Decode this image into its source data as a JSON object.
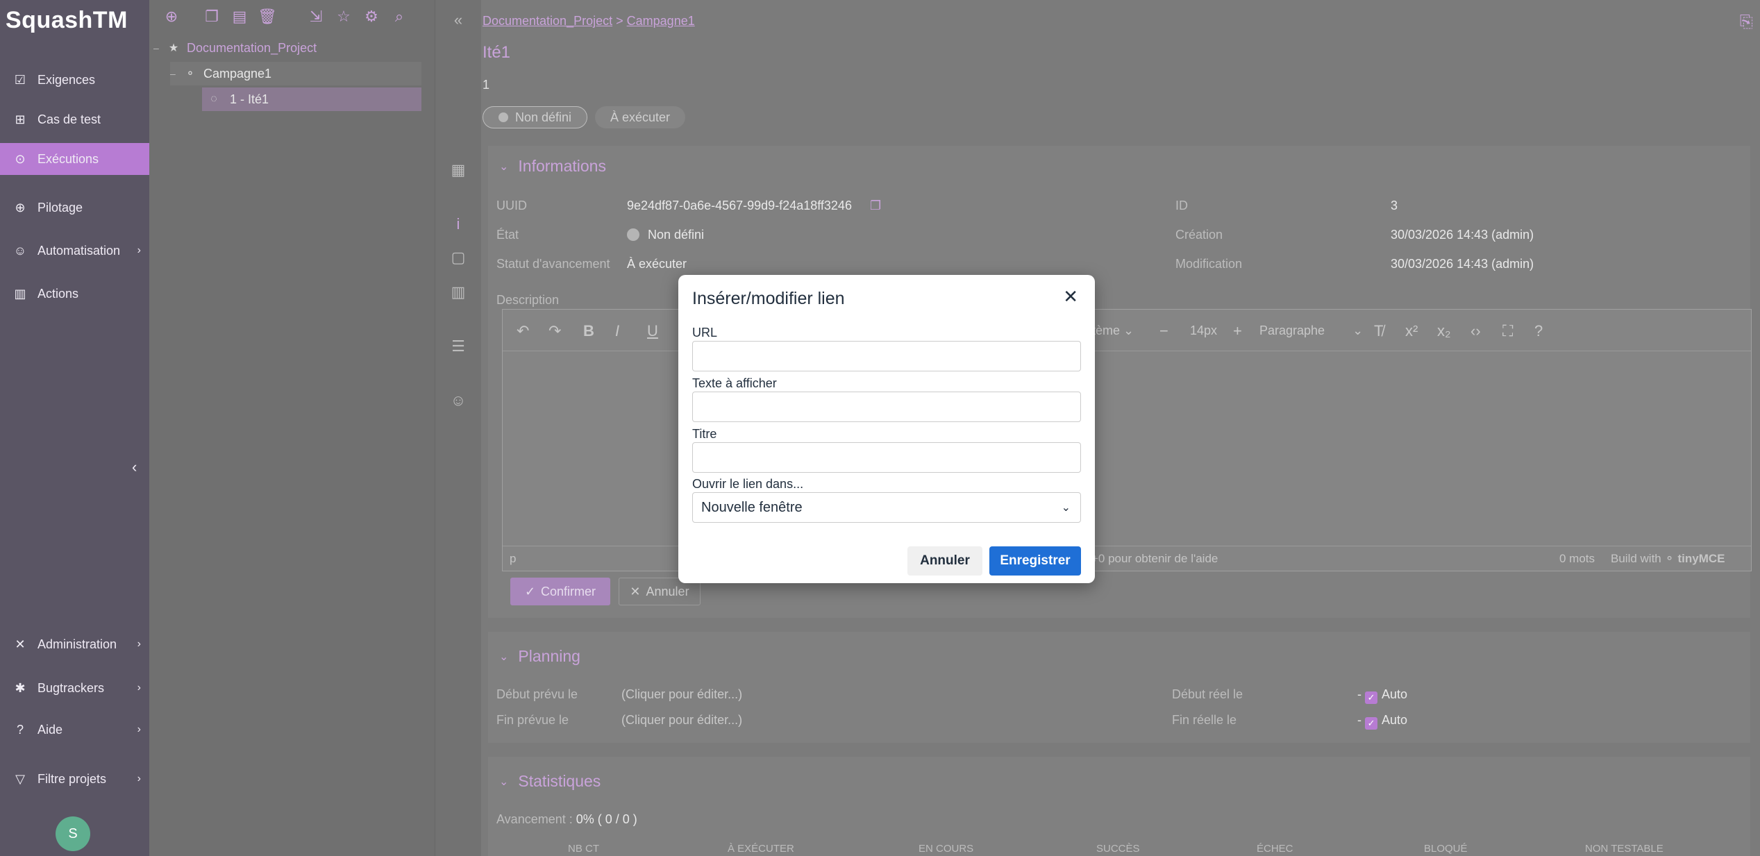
{
  "nav": {
    "logo": "SquashTM",
    "items": [
      {
        "label": "Exigences",
        "icon": "requirement-icon"
      },
      {
        "label": "Cas de test",
        "icon": "testcase-icon"
      },
      {
        "label": "Exécutions",
        "icon": "play-icon"
      },
      {
        "label": "Pilotage",
        "icon": "globe-icon"
      },
      {
        "label": "Automatisation",
        "icon": "robot-icon"
      },
      {
        "label": "Actions",
        "icon": "books-icon"
      },
      {
        "label": "Administration",
        "icon": "tools-icon"
      },
      {
        "label": "Bugtrackers",
        "icon": "bug-icon"
      },
      {
        "label": "Aide",
        "icon": "help-icon"
      },
      {
        "label": "Filtre projets",
        "icon": "filter-icon"
      }
    ],
    "avatar": "S"
  },
  "tree": {
    "project": "Documentation_Project",
    "campaign": "Campagne1",
    "iteration": "1 - Ité1"
  },
  "main": {
    "breadcrumb_project": "Documentation_Project",
    "breadcrumb_sep": ">",
    "breadcrumb_campaign": "Campagne1",
    "title": "Ité1",
    "reference": "1",
    "status_pill": "Non défini",
    "progress_pill": "À exécuter",
    "informations": {
      "heading": "Informations",
      "uuid_label": "UUID",
      "uuid_value": "9e24df87-0a6e-4567-99d9-f24a18ff3246",
      "state_label": "État",
      "state_value": "Non défini",
      "progress_label": "Statut d'avancement",
      "progress_value": "À exécuter",
      "id_label": "ID",
      "id_value": "3",
      "creation_label": "Création",
      "creation_value": "30/03/2026 14:43 (admin)",
      "modification_label": "Modification",
      "modification_value": "30/03/2026 14:43 (admin)",
      "description_label": "Description"
    },
    "editor": {
      "font_family": "stème",
      "font_size": "14px",
      "block_format": "Paragraphe",
      "path": "p",
      "help_hint": "+0 pour obtenir de l'aide",
      "word_count": "0 mots",
      "build_with": "Build with",
      "brand": "tinyMCE",
      "confirm": "Confirmer",
      "cancel": "Annuler"
    },
    "planning": {
      "heading": "Planning",
      "planned_start_label": "Début prévu le",
      "planned_start_value": "(Cliquer pour éditer...)",
      "planned_end_label": "Fin prévue le",
      "planned_end_value": "(Cliquer pour éditer...)",
      "actual_start_label": "Début réel le",
      "actual_end_label": "Fin réelle le",
      "dash": "-",
      "auto": "Auto"
    },
    "stats": {
      "heading": "Statistiques",
      "progress_label": "Avancement :",
      "progress_value": "0% ( 0 / 0 )",
      "columns": [
        "NB CT",
        "À EXÉCUTER",
        "EN COURS",
        "SUCCÈS",
        "ÉCHEC",
        "BLOQUÉ",
        "NON TESTABLE"
      ]
    }
  },
  "modal": {
    "title": "Insérer/modifier lien",
    "url_label": "URL",
    "url_value": "",
    "text_label": "Texte à afficher",
    "text_value": "",
    "title_label": "Titre",
    "title_value": "",
    "target_label": "Ouvrir le lien dans...",
    "target_value": "Nouvelle fenêtre",
    "cancel": "Annuler",
    "save": "Enregistrer"
  }
}
